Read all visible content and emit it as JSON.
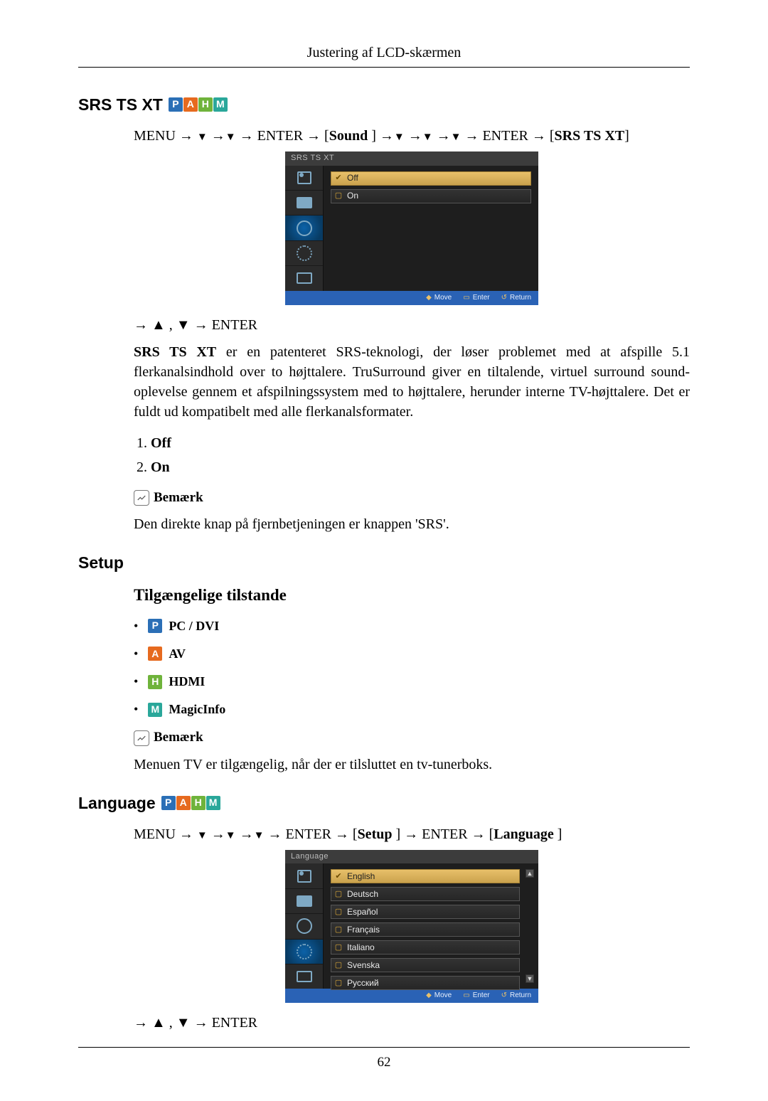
{
  "header": {
    "title": "Justering af LCD-skærmen"
  },
  "page_number": "62",
  "badges": {
    "p": "P",
    "a": "A",
    "h": "H",
    "m": "M"
  },
  "srs": {
    "heading": "SRS TS XT",
    "path": {
      "p1": "MENU → ",
      "p2": " →",
      "p3": " → ENTER → [",
      "p4": "Sound",
      "p5": "] →",
      "p6": "→",
      "p7": "→",
      "p8": "→ ENTER → [",
      "p9": "SRS TS XT",
      "p10": "]"
    },
    "osd": {
      "title": "SRS TS XT",
      "items": [
        "Off",
        "On"
      ],
      "footer": {
        "move": "Move",
        "enter": "Enter",
        "return": "Return"
      }
    },
    "arrow_line": "→ ▲ , ▼ → ENTER",
    "desc": {
      "lead": "SRS TS XT",
      "body": " er en patenteret SRS-teknologi, der løser problemet med at afspille 5.1 flerkanalsindhold over to højttalere. TruSurround giver en tiltalende, virtuel surround sound-oplevelse gennem et afspilningssystem med to højttalere, herunder interne TV-højttalere. Det er fuldt ud kompatibelt med alle flerkanalsformater."
    },
    "options": {
      "off": "Off",
      "on": "On"
    },
    "note_label": "Bemærk",
    "note_text": "Den direkte knap på fjernbetjeningen er knappen 'SRS'."
  },
  "setup": {
    "heading": "Setup",
    "sub_heading": "Tilgængelige tilstande",
    "modes": {
      "pc": "PC / DVI",
      "av": "AV",
      "hdmi": "HDMI",
      "mi": "MagicInfo"
    },
    "note_label": "Bemærk",
    "note_text_pre": "Menuen ",
    "note_text_bold": "TV",
    "note_text_post": " er tilgængelig, når der er tilsluttet en tv-tunerboks."
  },
  "language": {
    "heading": "Language",
    "path": {
      "p1": "MENU → ",
      "p2": " →",
      "p3": " →",
      "p4": " → ENTER → [",
      "p5": "Setup",
      "p6": "] → ENTER → [",
      "p7": "Language",
      "p8": " ]"
    },
    "osd": {
      "title": "Language",
      "items": [
        "English",
        "Deutsch",
        "Español",
        "Français",
        "Italiano",
        "Svenska",
        "Русский"
      ],
      "footer": {
        "move": "Move",
        "enter": "Enter",
        "return": "Return"
      }
    },
    "arrow_line": "→ ▲ , ▼ → ENTER"
  }
}
